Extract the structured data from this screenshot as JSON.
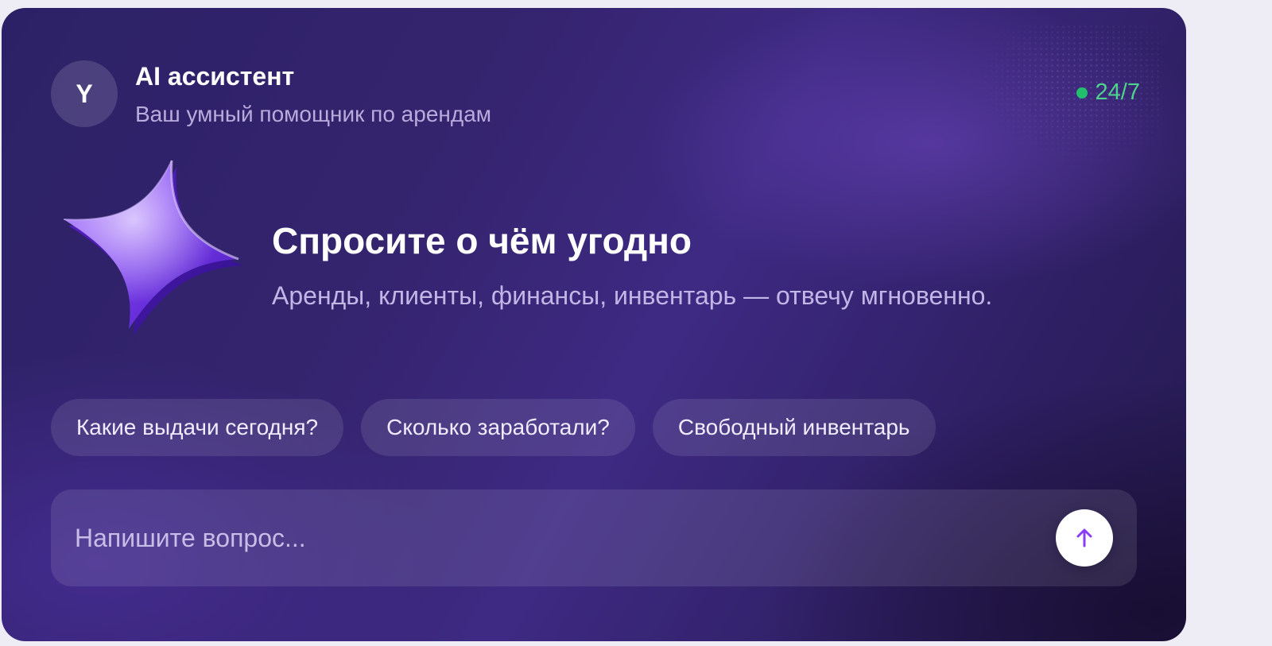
{
  "assistant": {
    "avatar_letter": "Y",
    "title": "AI ассистент",
    "subtitle": "Ваш умный помощник по арендам",
    "status": "24/7"
  },
  "hero": {
    "icon": "sparkle-star-icon",
    "headline": "Спросите о чём угодно",
    "tagline": "Аренды, клиенты, финансы, инвентарь — отвечу мгновенно."
  },
  "suggestions": [
    {
      "label": "Какие выдачи сегодня?"
    },
    {
      "label": "Сколько заработали?"
    },
    {
      "label": "Свободный инвентарь"
    }
  ],
  "composer": {
    "placeholder": "Напишите вопрос...",
    "value": "",
    "send_icon": "arrow-up-icon"
  },
  "colors": {
    "card_background": "#35246f",
    "status_green": "#22c06e",
    "send_arrow": "#8b3cf5"
  }
}
